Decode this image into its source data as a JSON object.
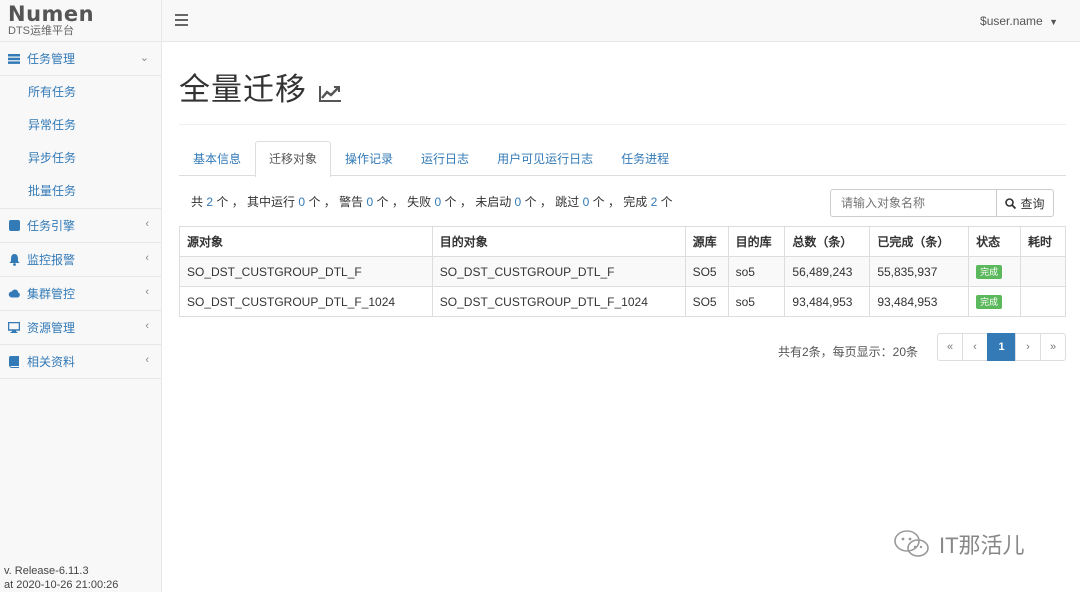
{
  "brand": {
    "name": "Numen",
    "subtitle": "DTS运维平台"
  },
  "sidebar": {
    "groups": [
      {
        "label": "任务管理",
        "icon": "server-icon",
        "expanded": true,
        "children": [
          "所有任务",
          "异常任务",
          "异步任务",
          "批量任务"
        ]
      },
      {
        "label": "任务引擎",
        "icon": "database-icon"
      },
      {
        "label": "监控报警",
        "icon": "bell-icon"
      },
      {
        "label": "集群管控",
        "icon": "cloud-icon"
      },
      {
        "label": "资源管理",
        "icon": "desktop-icon"
      },
      {
        "label": "相关资料",
        "icon": "book-icon"
      }
    ],
    "version_line1": "v. Release-6.11.3",
    "version_line2": "at 2020-10-26 21:00:26"
  },
  "topbar": {
    "user": "$user.name"
  },
  "page": {
    "title": "全量迁移"
  },
  "tabs": [
    "基本信息",
    "迁移对象",
    "操作记录",
    "运行日志",
    "用户可见运行日志",
    "任务进程"
  ],
  "active_tab": 1,
  "stats": {
    "p0": "共",
    "total": "2",
    "p1": "个 ，  其中运行",
    "running": "0",
    "p2": "个 ，  警告",
    "warning": "0",
    "p3": "个 ，  失败",
    "failed": "0",
    "p4": "个 ，  未启动",
    "not_started": "0",
    "p5": "个 ，  跳过",
    "skipped": "0",
    "p6": "个 ，  完成",
    "done": "2",
    "p7": "个"
  },
  "search": {
    "placeholder": "请输入对象名称",
    "button": "查询"
  },
  "table": {
    "columns": [
      "源对象",
      "目的对象",
      "源库",
      "目的库",
      "总数（条）",
      "已完成（条）",
      "状态",
      "耗时"
    ],
    "rows": [
      [
        "SO_DST_CUSTGROUP_DTL_F",
        "SO_DST_CUSTGROUP_DTL_F",
        "SO5",
        "so5",
        "56,489,243",
        "55,835,937",
        "完成",
        ""
      ],
      [
        "SO_DST_CUSTGROUP_DTL_F_1024",
        "SO_DST_CUSTGROUP_DTL_F_1024",
        "SO5",
        "so5",
        "93,484,953",
        "93,484,953",
        "完成",
        ""
      ]
    ]
  },
  "pagination": {
    "info": "共有2条，每页显示：20条",
    "first": "«",
    "prev": "‹",
    "current": "1",
    "next": "›",
    "last": "»"
  },
  "watermark": "IT那活儿",
  "colors": {
    "link": "#337ab7",
    "success": "#5cb85c",
    "sidebar_bg": "#f8f8f8"
  }
}
